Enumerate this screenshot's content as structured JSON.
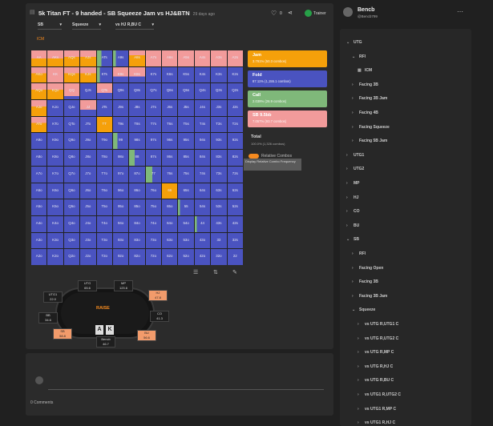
{
  "header": {
    "title": "5k Titan FT - 9 handed - SB Squeeze Jam vs HJ&BTN",
    "time": "29 days ago",
    "likes": "0",
    "trainer_label": "Trainer"
  },
  "selectors": [
    "SB",
    "Squeeze",
    "vs HJ R,BU C"
  ],
  "icm_tab": "ICM",
  "grid": {
    "hands": [
      [
        "AA",
        "AKs",
        "AQs",
        "AJs",
        "ATs",
        "A9s",
        "A8s",
        "A7s",
        "A6s",
        "A5s",
        "A4s",
        "A3s",
        "A2s"
      ],
      [
        "AKo",
        "KK",
        "KQs",
        "KJs",
        "KTs",
        "K9s",
        "K8s",
        "K7s",
        "K6s",
        "K5s",
        "K4s",
        "K3s",
        "K2s"
      ],
      [
        "AQo",
        "KQo",
        "QQ",
        "QJs",
        "QTs",
        "Q9s",
        "Q8s",
        "Q7s",
        "Q6s",
        "Q5s",
        "Q4s",
        "Q3s",
        "Q2s"
      ],
      [
        "AJo",
        "KJo",
        "QJo",
        "JJ",
        "JTs",
        "J9s",
        "J8s",
        "J7s",
        "J6s",
        "J5s",
        "J4s",
        "J3s",
        "J2s"
      ],
      [
        "ATo",
        "KTo",
        "QTo",
        "JTo",
        "TT",
        "T9s",
        "T8s",
        "T7s",
        "T6s",
        "T5s",
        "T4s",
        "T3s",
        "T2s"
      ],
      [
        "A9o",
        "K9o",
        "Q9o",
        "J9o",
        "T9o",
        "99",
        "98s",
        "97s",
        "96s",
        "95s",
        "94s",
        "93s",
        "92s"
      ],
      [
        "A8o",
        "K8o",
        "Q8o",
        "J8o",
        "T8o",
        "98o",
        "88",
        "87s",
        "86s",
        "85s",
        "84s",
        "83s",
        "82s"
      ],
      [
        "A7o",
        "K7o",
        "Q7o",
        "J7o",
        "T7o",
        "97o",
        "87o",
        "77",
        "76s",
        "75s",
        "74s",
        "73s",
        "72s"
      ],
      [
        "A6o",
        "K6o",
        "Q6o",
        "J6o",
        "T6o",
        "96o",
        "86o",
        "76o",
        "66",
        "65s",
        "64s",
        "63s",
        "62s"
      ],
      [
        "A5o",
        "K5o",
        "Q5o",
        "J5o",
        "T5o",
        "95o",
        "85o",
        "75o",
        "65o",
        "55",
        "54s",
        "53s",
        "52s"
      ],
      [
        "A4o",
        "K4o",
        "Q4o",
        "J4o",
        "T4o",
        "94o",
        "84o",
        "74o",
        "64o",
        "54o",
        "44",
        "43s",
        "42s"
      ],
      [
        "A3o",
        "K3o",
        "Q3o",
        "J3o",
        "T3o",
        "93o",
        "83o",
        "73o",
        "63o",
        "53o",
        "43o",
        "33",
        "32s"
      ],
      [
        "A2o",
        "K2o",
        "Q2o",
        "J2o",
        "T2o",
        "92o",
        "82o",
        "72o",
        "62o",
        "52o",
        "42o",
        "32o",
        "22"
      ]
    ]
  },
  "actions": [
    {
      "name": "Jam",
      "detail": "3.791% (50.3 combos)",
      "color": "#f5a00a"
    },
    {
      "name": "Fold",
      "detail": "87.11% (1,155.1 combos)",
      "color": "#4a53c0"
    },
    {
      "name": "Call",
      "detail": "2.039% (26.9 combos)",
      "color": "#7fb87a"
    },
    {
      "name": "SB 9.5bb",
      "detail": "7.057% (93.7 combos)",
      "color": "#f29b9b"
    }
  ],
  "total": {
    "label": "Total",
    "detail": "100.0% (1,326 combos)"
  },
  "relative_combos": "Relative Combos",
  "tooltip": "Display Relative Combo Frequency",
  "table": {
    "logo": "RAISE",
    "cards": [
      "A",
      "K"
    ],
    "seats": [
      {
        "name": "UTG",
        "stack": "65.6"
      },
      {
        "name": "MP",
        "stack": "123.6"
      },
      {
        "name": "UTG1",
        "stack": "22.0"
      },
      {
        "name": "HJ",
        "stack": "47.8"
      },
      {
        "name": "CO",
        "stack": "41.3"
      },
      {
        "name": "BU",
        "stack": "56.6"
      },
      {
        "name": "SB",
        "stack": "58.8"
      },
      {
        "name": "Bencb",
        "stack": "46.7"
      },
      {
        "name": "BB",
        "stack": "34.6"
      }
    ]
  },
  "comments": {
    "count": "0 Comments"
  },
  "profile": {
    "name": "Bencb",
    "handle": "@Bencb799"
  },
  "tree": [
    {
      "label": "UTG",
      "indent": 0,
      "open": true
    },
    {
      "label": "RFI",
      "indent": 1,
      "open": true
    },
    {
      "label": "ICM",
      "indent": 2,
      "icon": true
    },
    {
      "label": "Facing 3B",
      "indent": 1
    },
    {
      "label": "Facing 3B Jam",
      "indent": 1
    },
    {
      "label": "Facing 4B",
      "indent": 1
    },
    {
      "label": "Facing Squeeze",
      "indent": 1
    },
    {
      "label": "Facing 5B Jam",
      "indent": 1
    },
    {
      "label": "UTG1",
      "indent": 0
    },
    {
      "label": "UTG2",
      "indent": 0
    },
    {
      "label": "MP",
      "indent": 0
    },
    {
      "label": "HJ",
      "indent": 0
    },
    {
      "label": "CO",
      "indent": 0
    },
    {
      "label": "BU",
      "indent": 0
    },
    {
      "label": "SB",
      "indent": 0,
      "open": true
    },
    {
      "label": "RFI",
      "indent": 1
    },
    {
      "label": "Facing Open",
      "indent": 1
    },
    {
      "label": "Facing 3B",
      "indent": 1
    },
    {
      "label": "Facing 3B Jam",
      "indent": 1
    },
    {
      "label": "Squeeze",
      "indent": 1,
      "open": true
    },
    {
      "label": "vs UTG R,UTG1 C",
      "indent": 2
    },
    {
      "label": "vs UTG R,UTG2 C",
      "indent": 2
    },
    {
      "label": "vs UTG R,MP C",
      "indent": 2
    },
    {
      "label": "vs UTG R,HJ C",
      "indent": 2
    },
    {
      "label": "vs UTG R,BU C",
      "indent": 2
    },
    {
      "label": "vs UTG1 R,UTG2 C",
      "indent": 2
    },
    {
      "label": "vs UTG1 R,MP C",
      "indent": 2
    },
    {
      "label": "vs UTG1 R,HJ C",
      "indent": 2
    }
  ],
  "colors": {
    "fold": "#4a53c0",
    "jam": "#f5a00a",
    "call": "#7fb87a",
    "raise": "#f29b9b",
    "accent": "#f58a1f"
  }
}
